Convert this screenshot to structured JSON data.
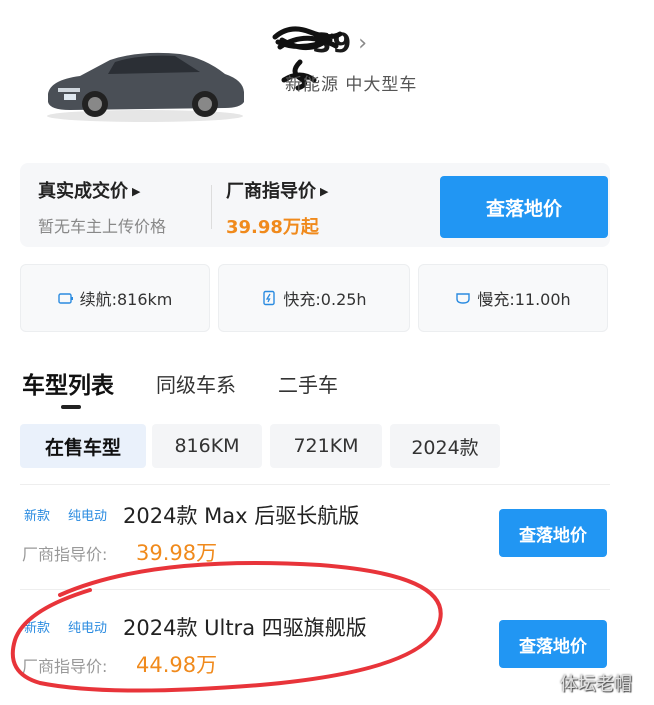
{
  "header": {
    "model_name": "S9",
    "model_subtitle": "新能源  中大型车"
  },
  "price_panel": {
    "real_price_title": "真实成交价",
    "real_price_sub": "暂无车主上传价格",
    "guide_title": "厂商指导价",
    "guide_price": "39.98万起",
    "button_label": "查落地价"
  },
  "specs": [
    {
      "icon": "battery-icon",
      "label": "续航:816km"
    },
    {
      "icon": "fast-charge-icon",
      "label": "快充:0.25h"
    },
    {
      "icon": "slow-charge-icon",
      "label": "慢充:11.00h"
    }
  ],
  "tabs": [
    "车型列表",
    "同级车系",
    "二手车"
  ],
  "filters": [
    "在售车型",
    "816KM",
    "721KM",
    "2024款"
  ],
  "trims": [
    {
      "tag_new": "新款",
      "tag_ev": "纯电动",
      "name": "2024款 Max 后驱长航版",
      "guide_label": "厂商指导价:",
      "price": "39.98万",
      "button_label": "查落地价"
    },
    {
      "tag_new": "新款",
      "tag_ev": "纯电动",
      "name": "2024款 Ultra 四驱旗舰版",
      "guide_label": "厂商指导价:",
      "price": "44.98万",
      "button_label": "查落地价"
    }
  ],
  "watermark": "体坛老帽",
  "colors": {
    "accent": "#2196f3",
    "price": "#f08a1c",
    "annotation": "#e8343a"
  }
}
